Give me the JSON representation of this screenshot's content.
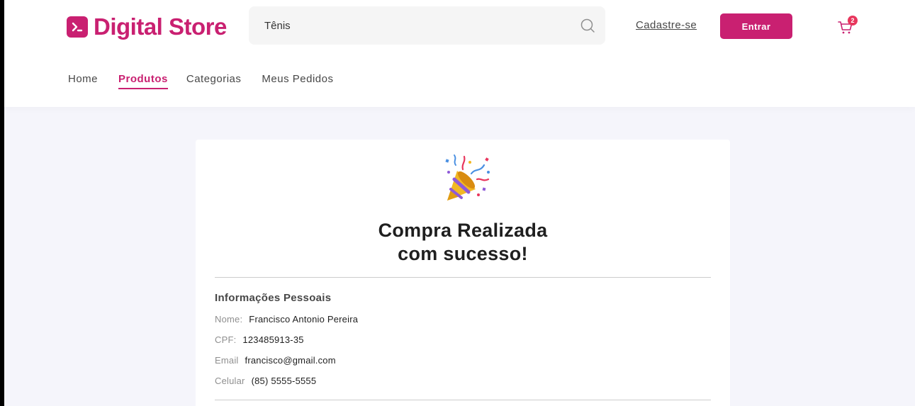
{
  "header": {
    "logo_text": "Digital Store",
    "search": {
      "value": "Tênis"
    },
    "signup_label": "Cadastre-se",
    "login_label": "Entrar",
    "cart_count": "2"
  },
  "nav": {
    "items": [
      {
        "label": "Home",
        "active": false
      },
      {
        "label": "Produtos",
        "active": true
      },
      {
        "label": "Categorias",
        "active": false
      },
      {
        "label": "Meus Pedidos",
        "active": false
      }
    ]
  },
  "confirmation": {
    "icon": "party-popper-icon",
    "title_line1": "Compra Realizada",
    "title_line2": "com sucesso!",
    "personal_info": {
      "heading": "Informações Pessoais",
      "fields": [
        {
          "label": "Nome:",
          "value": "Francisco Antonio Pereira"
        },
        {
          "label": "CPF:",
          "value": "123485913-35"
        },
        {
          "label": "Email",
          "value": "francisco@gmail.com"
        },
        {
          "label": "Celular",
          "value": "(85) 5555-5555"
        }
      ]
    }
  },
  "colors": {
    "brand": "#c92071",
    "badge": "#e8365d",
    "background": "#f5f5fb"
  }
}
